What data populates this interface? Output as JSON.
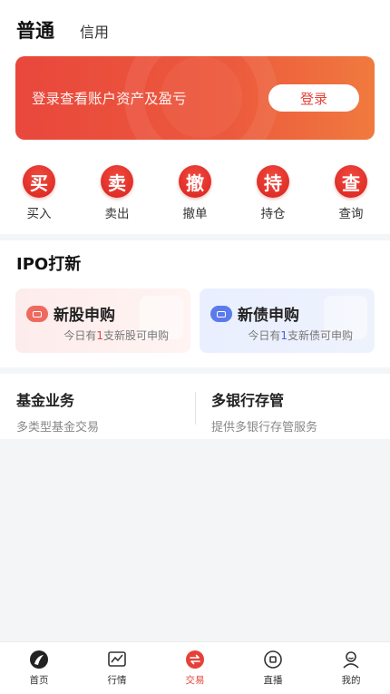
{
  "account_tabs": {
    "active": "普通",
    "other": "信用"
  },
  "banner": {
    "text": "登录查看账户资产及盈亏",
    "button": "登录"
  },
  "actions": [
    {
      "glyph": "买",
      "label": "买入"
    },
    {
      "glyph": "卖",
      "label": "卖出"
    },
    {
      "glyph": "撤",
      "label": "撤单"
    },
    {
      "glyph": "持",
      "label": "持仓"
    },
    {
      "glyph": "查",
      "label": "查询"
    }
  ],
  "ipo": {
    "title": "IPO打新",
    "stock": {
      "name": "新股申购",
      "pre": "今日有",
      "count": "1",
      "unit": "支",
      "post": "新股可申购"
    },
    "bond": {
      "name": "新债申购",
      "pre": "今日有",
      "count": "1",
      "unit": "支",
      "post": "新债可申购"
    }
  },
  "services": {
    "fund": {
      "title": "基金业务",
      "sub": "多类型基金交易"
    },
    "bank": {
      "title": "多银行存管",
      "sub": "提供多银行存管服务"
    }
  },
  "tabbar": [
    {
      "label": "首页",
      "icon": "home-logo-icon"
    },
    {
      "label": "行情",
      "icon": "chart-icon"
    },
    {
      "label": "交易",
      "icon": "trade-icon"
    },
    {
      "label": "直播",
      "icon": "live-icon"
    },
    {
      "label": "我的",
      "icon": "profile-icon"
    }
  ],
  "colors": {
    "accent": "#e5413a",
    "blue": "#3a66e6"
  }
}
